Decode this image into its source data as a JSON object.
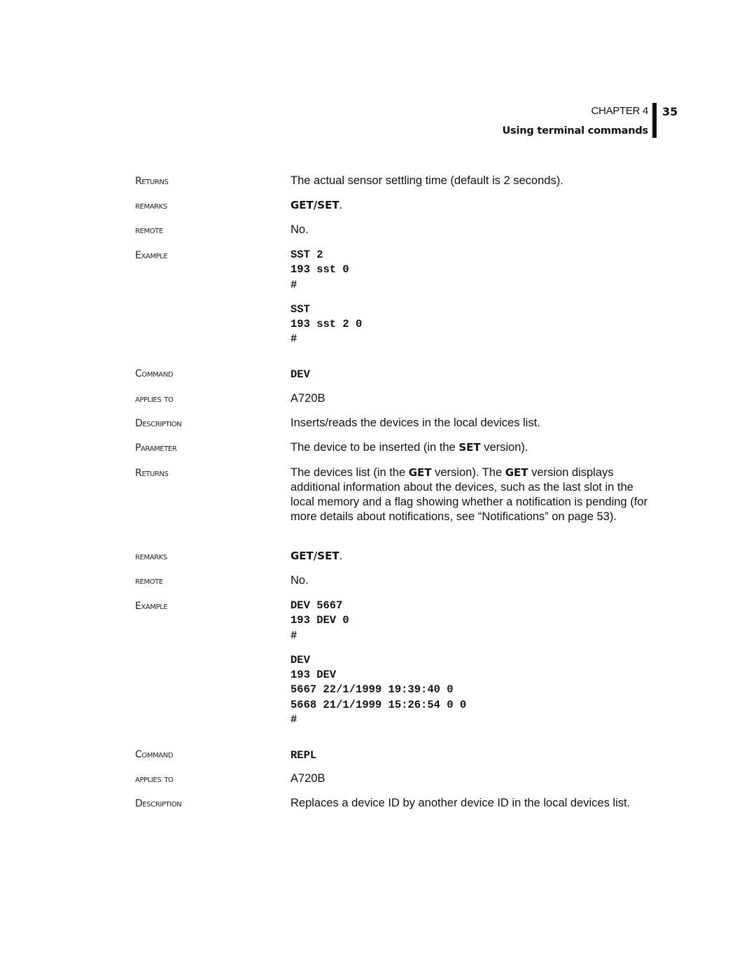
{
  "header": {
    "chapter": "CHAPTER 4",
    "section": "Using terminal commands",
    "page_number": "35"
  },
  "sst_tail": {
    "returns_label": "Returns",
    "returns_value": "The actual sensor settling time (default is 2 seconds).",
    "remarks_label": "remarks",
    "remarks_value": "GET/SET",
    "remarks_suffix": ".",
    "remote_label": "remote",
    "remote_value": "No.",
    "example_label": "Example",
    "examples": [
      [
        "SST 2",
        "193 sst 0",
        "#"
      ],
      [
        "SST",
        "193 sst 2 0",
        "#"
      ]
    ]
  },
  "dev": {
    "command_label": "Command",
    "command_value": "DEV",
    "applies_label": "applies to",
    "applies_value": "A720B",
    "description_label": "Description",
    "description_value": "Inserts/reads the devices in the local devices list.",
    "parameter_label": "Parameter",
    "parameter_pre": "The device to be inserted (in the ",
    "parameter_bold": "SET",
    "parameter_post": " version).",
    "returns_label": "Returns",
    "returns_p1": "The devices list (in the ",
    "returns_b1": "GET",
    "returns_p2": " version). The ",
    "returns_b2": "GET",
    "returns_p3": " version displays additional information about the devices, such as the last slot in the local memory and a flag showing whether a notification is pending (for more details about notifications, see “Notifications” on page 53).",
    "remarks_label": "remarks",
    "remarks_value": "GET/SET",
    "remarks_suffix": ".",
    "remote_label": "remote",
    "remote_value": "No.",
    "example_label": "Example",
    "examples": [
      [
        "DEV 5667",
        "193 DEV 0",
        "#"
      ],
      [
        "DEV",
        "193 DEV",
        "5667 22/1/1999 19:39:40 0",
        "5668 21/1/1999 15:26:54 0 0",
        "#"
      ]
    ]
  },
  "repl": {
    "command_label": "Command",
    "command_value": "REPL",
    "applies_label": "applies to",
    "applies_value": "A720B",
    "description_label": "Description",
    "description_value": "Replaces a device ID by another device ID in the local devices list."
  }
}
